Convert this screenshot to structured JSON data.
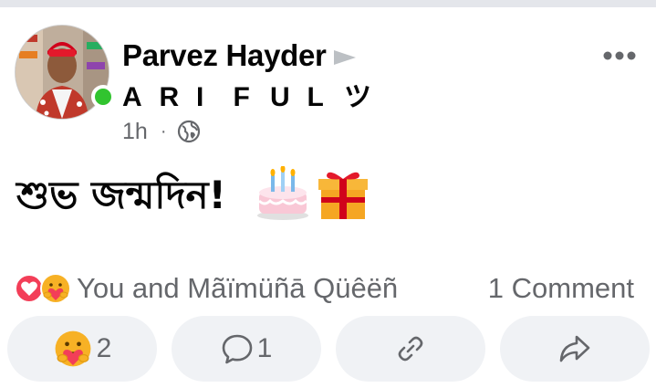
{
  "post": {
    "author": "Parvez Hayder",
    "tagged_name_letters": [
      "A",
      "R",
      "I",
      "F",
      "U",
      "L",
      "ツ"
    ],
    "time": "1h",
    "separator": "·",
    "text": "শুভ জন্মদিন!",
    "emojis": [
      "birthday-cake",
      "wrapped-gift"
    ]
  },
  "reactions": {
    "summary": "You and Mãïmüñā Qüêëñ",
    "types": [
      "love",
      "care"
    ],
    "comments": "1 Comment"
  },
  "actions": {
    "react_count": "2",
    "comment_count": "1"
  },
  "colors": {
    "online": "#31c42f",
    "muted_text": "#65676b",
    "pill_bg": "#f0f2f5",
    "love": "#f33e58",
    "care": "#f7b125"
  }
}
